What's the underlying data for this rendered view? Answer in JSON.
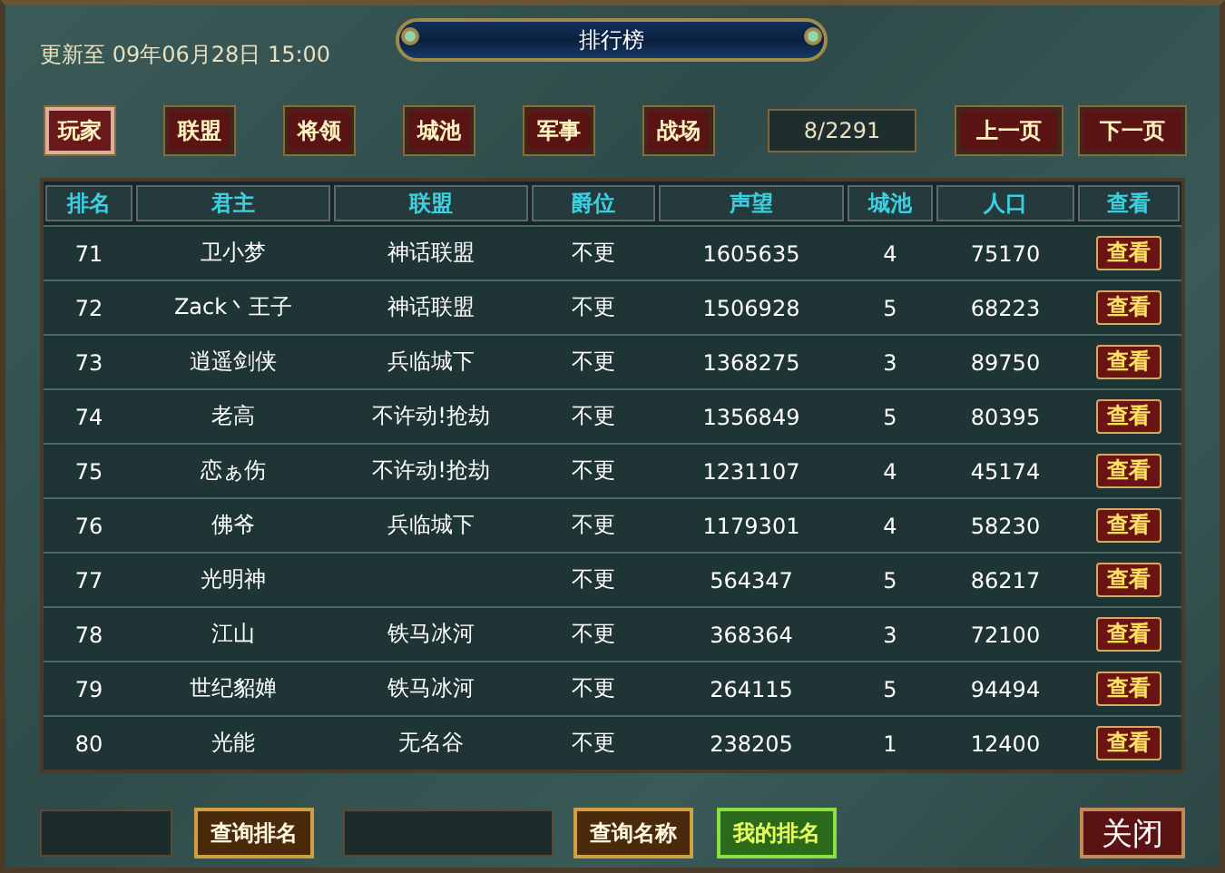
{
  "updated": "更新至 09年06月28日 15:00",
  "title": "排行榜",
  "tabs": [
    {
      "label": "玩家",
      "selected": true
    },
    {
      "label": "联盟",
      "selected": false
    },
    {
      "label": "将领",
      "selected": false
    },
    {
      "label": "城池",
      "selected": false
    },
    {
      "label": "军事",
      "selected": false
    },
    {
      "label": "战场",
      "selected": false
    }
  ],
  "page": "8/2291",
  "prev_button": "上一页",
  "next_button": "下一页",
  "table": {
    "columns": [
      "排名",
      "君主",
      "联盟",
      "爵位",
      "声望",
      "城池",
      "人口",
      "查看"
    ],
    "rows": [
      [
        "71",
        "卫小梦",
        "神话联盟",
        "不更",
        "1605635",
        "4",
        "75170",
        "查看"
      ],
      [
        "72",
        "Zack丶王子",
        "神话联盟",
        "不更",
        "1506928",
        "5",
        "68223",
        "查看"
      ],
      [
        "73",
        "逍遥剑侠",
        "兵临城下",
        "不更",
        "1368275",
        "3",
        "89750",
        "查看"
      ],
      [
        "74",
        "老高",
        "不许动!抢劫",
        "不更",
        "1356849",
        "5",
        "80395",
        "查看"
      ],
      [
        "75",
        "恋ぁ伤",
        "不许动!抢劫",
        "不更",
        "1231107",
        "4",
        "45174",
        "查看"
      ],
      [
        "76",
        "佛爷",
        "兵临城下",
        "不更",
        "1179301",
        "4",
        "58230",
        "查看"
      ],
      [
        "77",
        "光明神",
        "",
        "不更",
        "564347",
        "5",
        "86217",
        "查看"
      ],
      [
        "78",
        "江山",
        "铁马冰河",
        "不更",
        "368364",
        "3",
        "72100",
        "查看"
      ],
      [
        "79",
        "世纪貂婵",
        "铁马冰河",
        "不更",
        "264115",
        "5",
        "94494",
        "查看"
      ],
      [
        "80",
        "光能",
        "无名谷",
        "不更",
        "238205",
        "1",
        "12400",
        "查看"
      ]
    ]
  },
  "search_rank_button": "查询排名",
  "search_name_button": "查询名称",
  "my_rank_button": "我的排名",
  "close_button": "关闭"
}
